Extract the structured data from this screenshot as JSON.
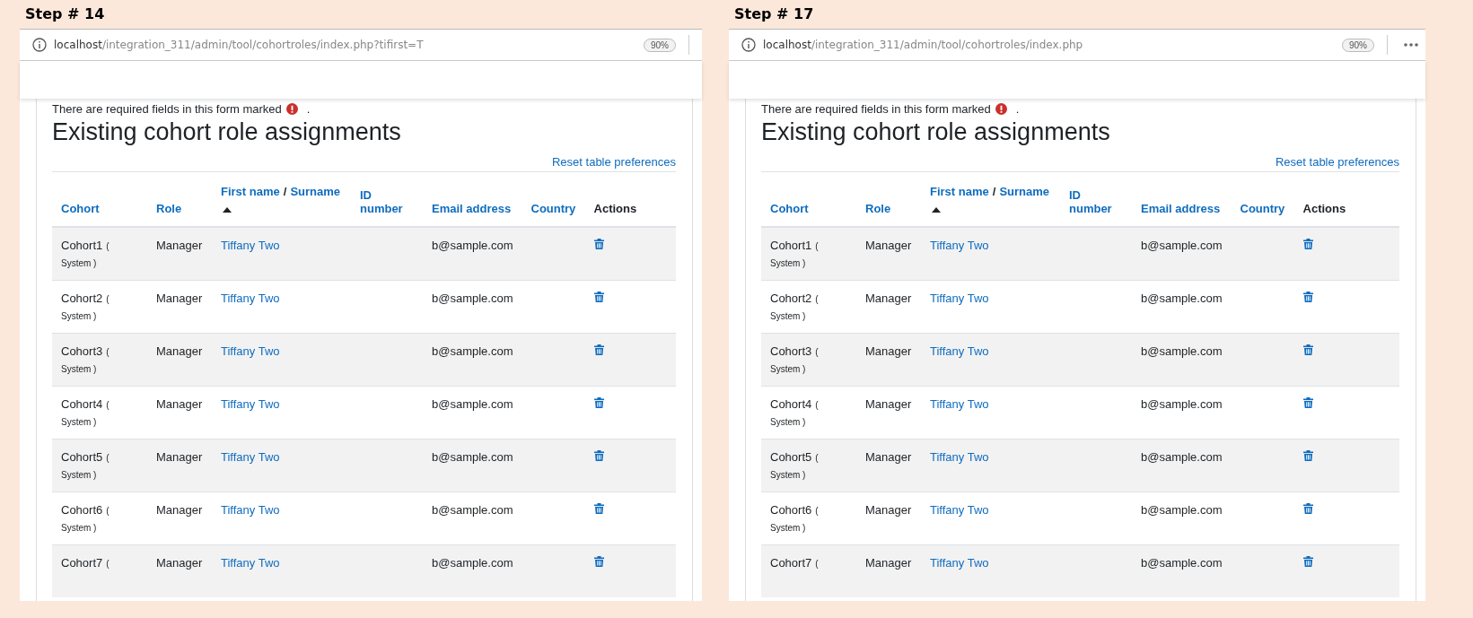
{
  "panels": [
    {
      "step_label": "Step # 14",
      "url_host": "localhost",
      "url_path": "/integration_311/admin/tool/cohortroles/index.php?tifirst=T",
      "zoom": "90%",
      "menu": false,
      "required_note": "There are required fields in this form marked",
      "note_end": ".",
      "heading": "Existing cohort role assignments",
      "reset_link": "Reset table preferences",
      "columns": [
        {
          "kind": "link",
          "label": "Cohort"
        },
        {
          "kind": "link",
          "label": "Role"
        },
        {
          "kind": "pair",
          "first": "First name",
          "separator": "/",
          "second": "Surname",
          "sorted": true
        },
        {
          "kind": "link",
          "label": "ID number"
        },
        {
          "kind": "link",
          "label": "Email address"
        },
        {
          "kind": "link",
          "label": "Country"
        },
        {
          "kind": "plain",
          "label": "Actions"
        }
      ],
      "rows": [
        {
          "cohort": "Cohort1",
          "context_open": "(",
          "context": "System )",
          "role": "Manager",
          "name": "Tiffany Two",
          "email": "b@sample.com"
        },
        {
          "cohort": "Cohort2",
          "context_open": "(",
          "context": "System )",
          "role": "Manager",
          "name": "Tiffany Two",
          "email": "b@sample.com"
        },
        {
          "cohort": "Cohort3",
          "context_open": "(",
          "context": "System )",
          "role": "Manager",
          "name": "Tiffany Two",
          "email": "b@sample.com"
        },
        {
          "cohort": "Cohort4",
          "context_open": "(",
          "context": "System )",
          "role": "Manager",
          "name": "Tiffany Two",
          "email": "b@sample.com"
        },
        {
          "cohort": "Cohort5",
          "context_open": "(",
          "context": "System )",
          "role": "Manager",
          "name": "Tiffany Two",
          "email": "b@sample.com"
        },
        {
          "cohort": "Cohort6",
          "context_open": "(",
          "context": "System )",
          "role": "Manager",
          "name": "Tiffany Two",
          "email": "b@sample.com"
        },
        {
          "cohort": "Cohort7",
          "context_open": "(",
          "role": "Manager",
          "name": "Tiffany Two",
          "email": "b@sample.com"
        }
      ]
    },
    {
      "step_label": "Step # 17",
      "url_host": "localhost",
      "url_path": "/integration_311/admin/tool/cohortroles/index.php",
      "zoom": "90%",
      "menu": true,
      "required_note": "There are required fields in this form marked",
      "note_end": ".",
      "heading": "Existing cohort role assignments",
      "reset_link": "Reset table preferences",
      "columns": [
        {
          "kind": "link",
          "label": "Cohort"
        },
        {
          "kind": "link",
          "label": "Role"
        },
        {
          "kind": "pair",
          "first": "First name",
          "separator": "/",
          "second": "Surname",
          "sorted": true
        },
        {
          "kind": "link",
          "label": "ID number"
        },
        {
          "kind": "link",
          "label": "Email address"
        },
        {
          "kind": "link",
          "label": "Country"
        },
        {
          "kind": "plain",
          "label": "Actions"
        }
      ],
      "rows": [
        {
          "cohort": "Cohort1",
          "context_open": "(",
          "context": "System )",
          "role": "Manager",
          "name": "Tiffany Two",
          "email": "b@sample.com"
        },
        {
          "cohort": "Cohort2",
          "context_open": "(",
          "context": "System )",
          "role": "Manager",
          "name": "Tiffany Two",
          "email": "b@sample.com"
        },
        {
          "cohort": "Cohort3",
          "context_open": "(",
          "context": "System )",
          "role": "Manager",
          "name": "Tiffany Two",
          "email": "b@sample.com"
        },
        {
          "cohort": "Cohort4",
          "context_open": "(",
          "context": "System )",
          "role": "Manager",
          "name": "Tiffany Two",
          "email": "b@sample.com"
        },
        {
          "cohort": "Cohort5",
          "context_open": "(",
          "context": "System )",
          "role": "Manager",
          "name": "Tiffany Two",
          "email": "b@sample.com"
        },
        {
          "cohort": "Cohort6",
          "context_open": "(",
          "context": "System )",
          "role": "Manager",
          "name": "Tiffany Two",
          "email": "b@sample.com"
        },
        {
          "cohort": "Cohort7",
          "context_open": "(",
          "role": "Manager",
          "name": "Tiffany Two",
          "email": "b@sample.com"
        }
      ]
    }
  ]
}
